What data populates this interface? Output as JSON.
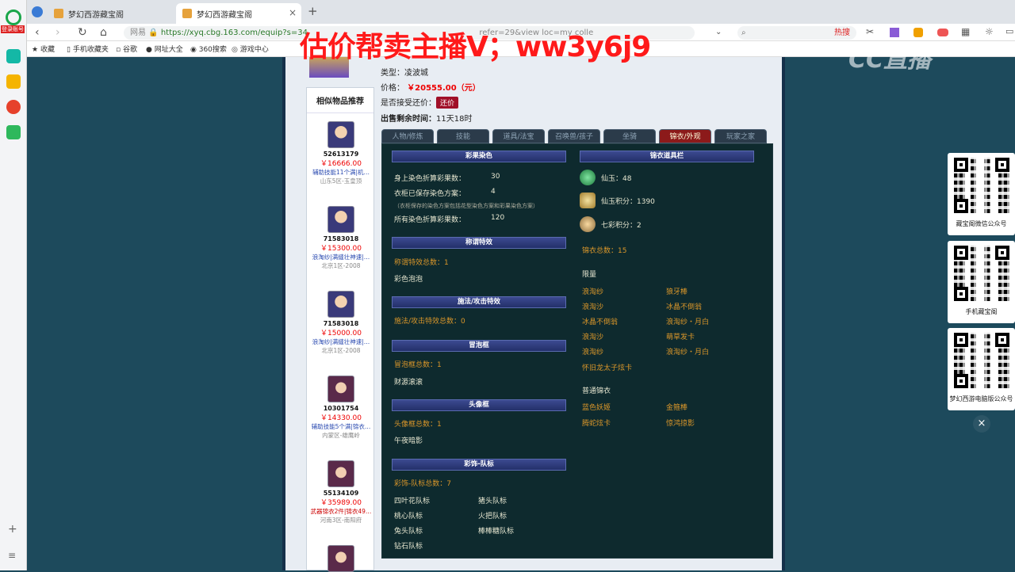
{
  "browser": {
    "tabs": [
      {
        "label": "梦幻西游藏宝阁"
      },
      {
        "label": "梦幻西游藏宝阁"
      }
    ],
    "url_host": "网易",
    "url": "https://xyq.cbg.163.com/equip?s=34",
    "url_tail": "refer=29&view loc=my colle",
    "search_placeholder": "热搜",
    "bookmarks": [
      "收藏",
      "手机收藏夹",
      "谷歌",
      "网址大全",
      "360搜索",
      "游戏中心"
    ],
    "left_label": "登录账号"
  },
  "overlay": {
    "banner": "估价帮卖主播V；ww3y6j9",
    "logo": "CC直播",
    "qr_captions": [
      "藏宝阁微信公众号",
      "手机藏宝阁",
      "梦幻西游电脑版公众号"
    ]
  },
  "item": {
    "type_label": "类型：",
    "type_value": "凌波城",
    "price_label": "价格：",
    "price_value": "￥20555.00（元）",
    "counter_label": "是否接受还价：",
    "counter_button": "还价",
    "time_label": "出售剩余时间：",
    "time_value": "11天18时"
  },
  "recommend": {
    "title": "相似物品推荐",
    "items": [
      {
        "id": "52613179",
        "price": "￥16666.00",
        "desc": "辅助技能11个满|机…",
        "server": "山东5区-玉皇顶",
        "red": false
      },
      {
        "id": "71583018",
        "price": "￥15300.00",
        "desc": "浪淘纱|满缝壮神速|…",
        "server": "北京1区-2008",
        "red": false
      },
      {
        "id": "71583018",
        "price": "￥15000.00",
        "desc": "浪淘纱|满缝壮神速|…",
        "server": "北京1区-2008",
        "red": false
      },
      {
        "id": "10301754",
        "price": "￥14330.00",
        "desc": "辅助技能5个满|锦衣…",
        "server": "内蒙区-雄鹰岭",
        "red": false
      },
      {
        "id": "55134109",
        "price": "￥35989.00",
        "desc": "武器锦衣2件|锦衣49…",
        "server": "河南3区-南阳府",
        "red": true
      }
    ]
  },
  "game_tabs": [
    "人物/修炼",
    "技能",
    "道具/法宝",
    "召唤兽/孩子",
    "坐骑",
    "锦衣/外观",
    "玩家之家"
  ],
  "active_tab": "锦衣/外观",
  "left": {
    "dye": {
      "title": "彩果染色",
      "body_label": "身上染色折算彩果数：",
      "body_value": "30",
      "wardrobe_label": "衣柜已保存染色方案：",
      "wardrobe_value": "4",
      "note": "（衣柜保存的染色方案包括花型染色方案和彩果染色方案）",
      "all_label": "所有染色折算彩果数：",
      "all_value": "120"
    },
    "title_fx": {
      "title": "称谓特效",
      "total": "称谓特效总数：1",
      "items": [
        "彩色泡泡"
      ]
    },
    "spell_fx": {
      "title": "施法/攻击特效",
      "total": "施法/攻击特效总数：0"
    },
    "bubble": {
      "title": "冒泡框",
      "total": "冒泡框总数：1",
      "items": [
        "财源滚滚"
      ]
    },
    "avatar_frame": {
      "title": "头像框",
      "total": "头像框总数：1",
      "items": [
        "午夜暗影"
      ]
    },
    "team": {
      "title": "彩饰-队标",
      "total": "彩饰-队标总数：7",
      "items": [
        "四叶花队标",
        "猪头队标",
        "桃心队标",
        "火把队标",
        "兔头队标",
        "棒棒糖队标",
        "钻石队标"
      ]
    }
  },
  "right": {
    "title": "锦衣道具栏",
    "xianyu": "仙玉：48",
    "xianyu_points": "仙玉积分：1390",
    "qicai_points": "七彩积分：2",
    "jinyi_total": "锦衣总数：15",
    "limited_title": "限量",
    "limited": [
      "浪淘纱",
      "狼牙棒",
      "浪淘沙",
      "冰晶不倒翁",
      "冰晶不倒翁",
      "浪淘纱・月白",
      "浪淘沙",
      "萌草发卡",
      "浪淘纱",
      "浪淘纱・月白",
      "怀旧龙太子炫卡"
    ],
    "normal_title": "普通锦衣",
    "normal": [
      "蓝色妖姬",
      "金箍棒",
      "腾蛇炫卡",
      "惊鸿掠影"
    ]
  },
  "colors": {
    "accent": "#a01028",
    "panel": "#0e2a2e",
    "gold": "#d9962a",
    "banner": "#ff1a1a"
  }
}
